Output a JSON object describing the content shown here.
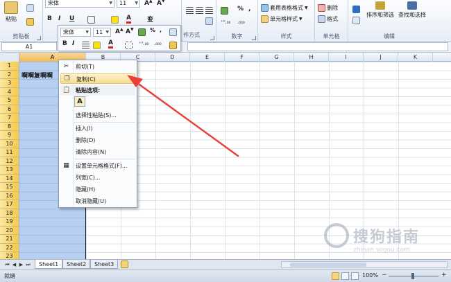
{
  "ribbon": {
    "clipboard": {
      "paste_label": "粘贴",
      "group_label": "剪贴板"
    },
    "font": {
      "font_name": "宋体",
      "font_size": "11",
      "bold": "B",
      "italic": "I",
      "underline": "U",
      "wen": "变"
    },
    "alignment": {
      "group_label": "对齐方式"
    },
    "number": {
      "format": "%",
      "comma": ",",
      "group_label": "数字"
    },
    "styles": {
      "table_style": "套用表格格式",
      "cell_style": "单元格样式",
      "group_label": "样式"
    },
    "cells": {
      "delete": "删除",
      "format": "格式",
      "group_label": "单元格"
    },
    "editing": {
      "sort_filter": "排序和筛选",
      "find_select": "查找和选择",
      "group_label": "编辑"
    }
  },
  "formula_bar": {
    "name_box": "A1"
  },
  "mini_toolbar": {
    "font_name": "宋体",
    "font_size": "11",
    "bold": "B",
    "italic": "I",
    "format_label": "作方式"
  },
  "columns": [
    "A",
    "B",
    "C",
    "D",
    "E",
    "F",
    "G",
    "H",
    "I",
    "J",
    "K"
  ],
  "rows": [
    "1",
    "2",
    "3",
    "4",
    "5",
    "6",
    "7",
    "8",
    "9",
    "10",
    "11",
    "12",
    "13",
    "14",
    "15",
    "16",
    "17",
    "18",
    "19",
    "20",
    "21",
    "22",
    "23"
  ],
  "cell_a2": "啊啊复啊啊",
  "context_menu": {
    "cut": "剪切(T)",
    "copy": "复制(C)",
    "paste_options": "粘贴选项:",
    "paste_a": "A",
    "paste_special": "选择性粘贴(S)...",
    "insert": "插入(I)",
    "delete": "删除(D)",
    "clear": "清除内容(N)",
    "format_cells": "设置单元格格式(F)...",
    "col_width": "列宽(C)...",
    "hide": "隐藏(H)",
    "unhide": "取消隐藏(U)"
  },
  "sheets": [
    "Sheet1",
    "Sheet2",
    "Sheet3"
  ],
  "status": {
    "ready": "就绪",
    "zoom": "100%",
    "zoom_minus": "−",
    "zoom_plus": "+"
  },
  "watermark": {
    "text": "搜狗指南",
    "url": "zhinan.sogou.com"
  },
  "colors": {
    "accent_red": "#e8413a",
    "selection_blue": "#aac8f0",
    "row_header_gold": "#f5c94a"
  }
}
